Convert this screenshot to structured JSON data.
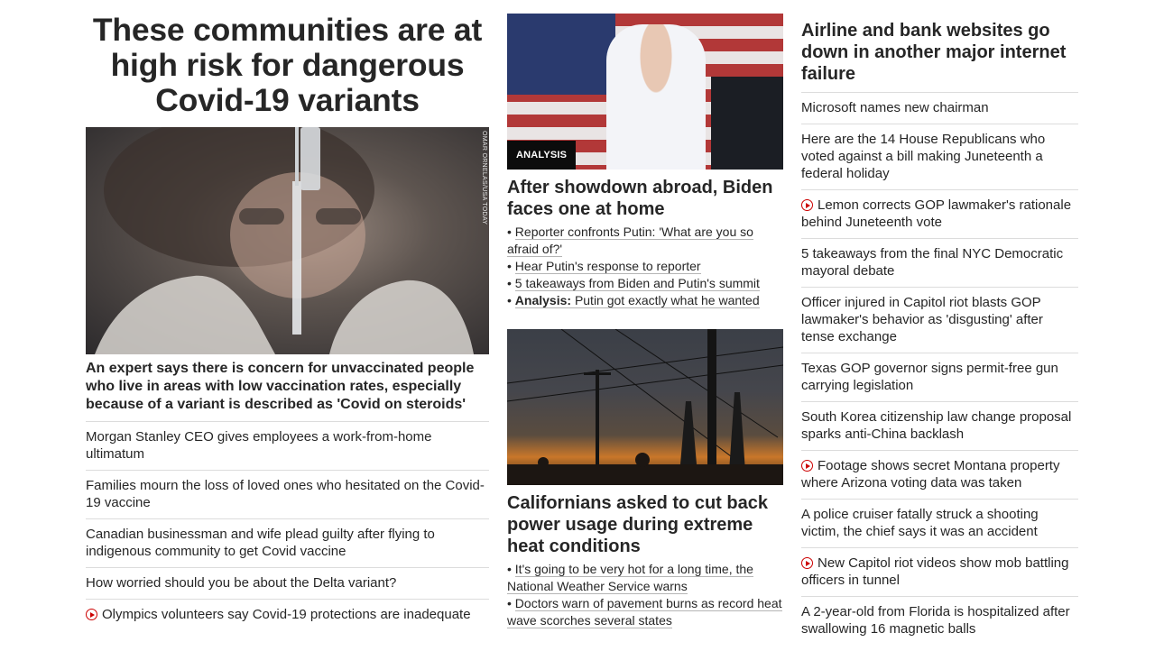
{
  "col1": {
    "headline": "These communities are at high risk for dangerous Covid-19 variants",
    "image_credit": "OMAR ORNELAS/USA TODAY",
    "subhead": "An expert says there is concern for unvaccinated people who live in areas with low vaccination rates, especially because of a variant is described as 'Covid on steroids'",
    "items": [
      {
        "text": "Morgan Stanley CEO gives employees a work-from-home ultimatum",
        "video": false
      },
      {
        "text": "Families mourn the loss of loved ones who hesitated on the Covid-19 vaccine",
        "video": false
      },
      {
        "text": "Canadian businessman and wife plead guilty after flying to indigenous community to get Covid vaccine",
        "video": false
      },
      {
        "text": "How worried should you be about the Delta variant?",
        "video": false
      },
      {
        "text": "Olympics volunteers say Covid-19 protections are inadequate",
        "video": true
      }
    ]
  },
  "col2": {
    "story1": {
      "badge": "ANALYSIS",
      "title": "After showdown abroad, Biden faces one at home",
      "bullets": [
        {
          "prefix": "",
          "text": "Reporter confronts Putin: 'What are you so afraid of?'"
        },
        {
          "prefix": "",
          "text": "Hear Putin's response to reporter"
        },
        {
          "prefix": "",
          "text": "5 takeaways from Biden and Putin's summit"
        },
        {
          "prefix": "Analysis:",
          "text": "Putin got exactly what he wanted"
        }
      ]
    },
    "story2": {
      "title": "Californians asked to cut back power usage during extreme heat conditions",
      "bullets": [
        {
          "prefix": "",
          "text": "It's going to be very hot for a long time, the National Weather Service warns"
        },
        {
          "prefix": "",
          "text": "Doctors warn of pavement burns as record heat wave scorches several states"
        }
      ]
    }
  },
  "col3": {
    "headline": "Airline and bank websites go down in another major internet failure",
    "items": [
      {
        "text": "Microsoft names new chairman",
        "video": false
      },
      {
        "text": "Here are the 14 House Republicans who voted against a bill making Juneteenth a federal holiday",
        "video": false
      },
      {
        "text": "Lemon corrects GOP lawmaker's rationale behind Juneteenth vote",
        "video": true
      },
      {
        "text": "5 takeaways from the final NYC Democratic mayoral debate",
        "video": false
      },
      {
        "text": "Officer injured in Capitol riot blasts GOP lawmaker's behavior as 'disgusting' after tense exchange",
        "video": false
      },
      {
        "text": "Texas GOP governor signs permit-free gun carrying legislation",
        "video": false
      },
      {
        "text": "South Korea citizenship law change proposal sparks anti-China backlash",
        "video": false
      },
      {
        "text": "Footage shows secret Montana property where Arizona voting data was taken",
        "video": true
      },
      {
        "text": "A police cruiser fatally struck a shooting victim, the chief says it was an accident",
        "video": false
      },
      {
        "text": "New Capitol riot videos show mob battling officers in tunnel",
        "video": true
      },
      {
        "text": "A 2-year-old from Florida is hospitalized after swallowing 16 magnetic balls",
        "video": false
      }
    ]
  },
  "colors": {
    "text": "#262626",
    "divider": "#dcdcdc",
    "video_icon": "#cc0000",
    "badge_bg": "#0c0c0c"
  },
  "icons": {
    "video": "play-circle-icon"
  }
}
